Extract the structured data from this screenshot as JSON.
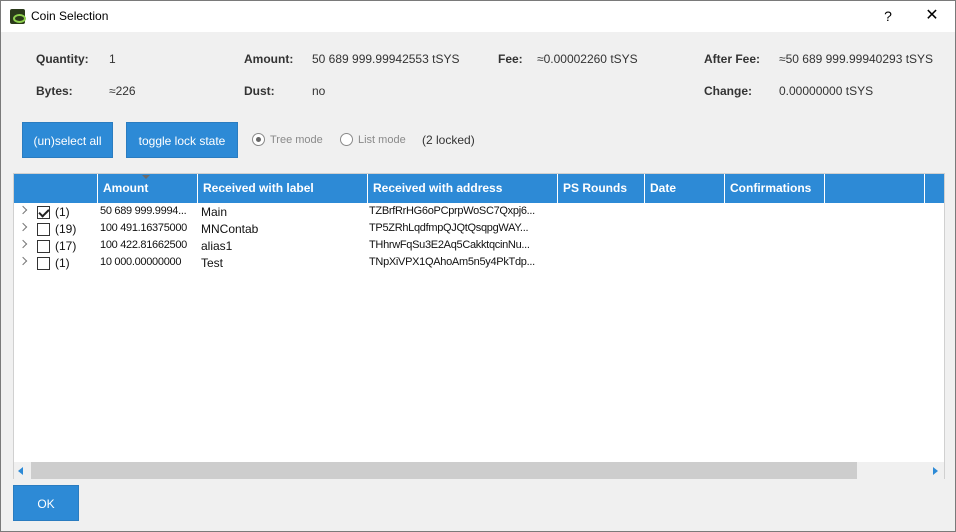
{
  "window": {
    "title": "Coin Selection",
    "help": "?",
    "close": "✕"
  },
  "summary": {
    "quantity_label": "Quantity:",
    "quantity_value": "1",
    "amount_label": "Amount:",
    "amount_value": "50 689 999.99942553 tSYS",
    "fee_label": "Fee:",
    "fee_value": "≈0.00002260 tSYS",
    "after_fee_label": "After Fee:",
    "after_fee_value": "≈50 689 999.99940293 tSYS",
    "bytes_label": "Bytes:",
    "bytes_value": "≈226",
    "dust_label": "Dust:",
    "dust_value": "no",
    "change_label": "Change:",
    "change_value": "0.00000000 tSYS"
  },
  "controls": {
    "select_all": "(un)select all",
    "toggle_lock": "toggle lock state",
    "tree_mode": "Tree mode",
    "list_mode": "List mode",
    "mode_selected": "tree",
    "locked": "(2 locked)"
  },
  "table": {
    "columns": [
      "Amount",
      "Received with label",
      "Received with address",
      "PS Rounds",
      "Date",
      "Confirmations"
    ],
    "sort_column": "Amount",
    "rows": [
      {
        "checked": true,
        "count": "(1)",
        "amount": "50 689 999.9994...",
        "label": "Main",
        "address": "TZBrfRrHG6oPCprpWoSC7Qxpj6..."
      },
      {
        "checked": false,
        "count": "(19)",
        "amount": "100 491.16375000",
        "label": "MNContab",
        "address": "TP5ZRhLqdfmpQJQtQsqpgWAY..."
      },
      {
        "checked": false,
        "count": "(17)",
        "amount": "100 422.81662500",
        "label": "alias1",
        "address": "THhrwFqSu3E2Aq5CakktqcinNu..."
      },
      {
        "checked": false,
        "count": "(1)",
        "amount": "10 000.00000000",
        "label": "Test",
        "address": "TNpXiVPX1QAhoAm5n5y4PkTdp..."
      }
    ]
  },
  "footer": {
    "ok": "OK"
  },
  "colors": {
    "accent": "#2d8ad6",
    "background": "#f0f0f0"
  }
}
